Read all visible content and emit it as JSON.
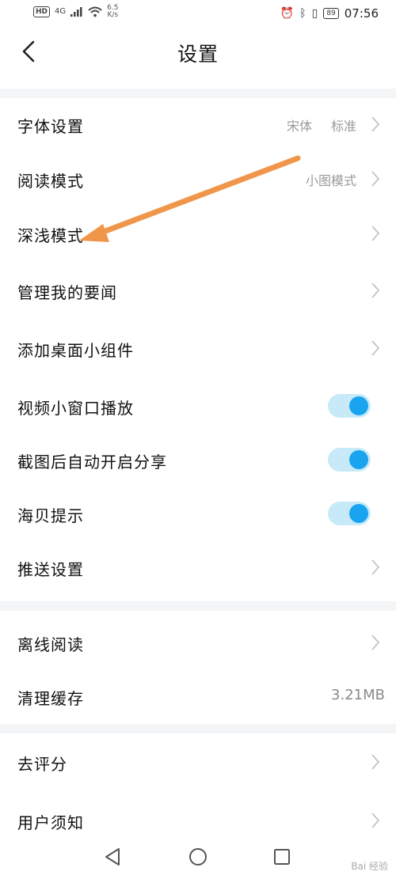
{
  "status_bar": {
    "hd": "HD",
    "network": "4G",
    "speed_value": "6.5",
    "speed_unit": "K/s",
    "battery": "89",
    "time": "07:56"
  },
  "header": {
    "title": "设置"
  },
  "rows": [
    {
      "label": "字体设置",
      "values": [
        "宋体",
        "标准"
      ]
    },
    {
      "label": "阅读模式",
      "value": "小图模式"
    },
    {
      "label": "深浅模式"
    },
    {
      "label": "管理我的要闻"
    },
    {
      "label": "添加桌面小组件"
    },
    {
      "label": "视频小窗口播放",
      "toggle": true
    },
    {
      "label": "截图后自动开启分享",
      "toggle": true
    },
    {
      "label": "海贝提示",
      "toggle": true
    },
    {
      "label": "推送设置"
    },
    {
      "label": "离线阅读"
    },
    {
      "label": "清理缓存",
      "value": "3.21MB"
    },
    {
      "label": "去评分"
    },
    {
      "label": "用户须知"
    }
  ],
  "watermark": "Bai 经验",
  "colors": {
    "toggle_on": "#1aa3ef",
    "toggle_track": "#c8eaf8",
    "arrow": "#f0964a",
    "section_gap": "#f4f5f7"
  }
}
